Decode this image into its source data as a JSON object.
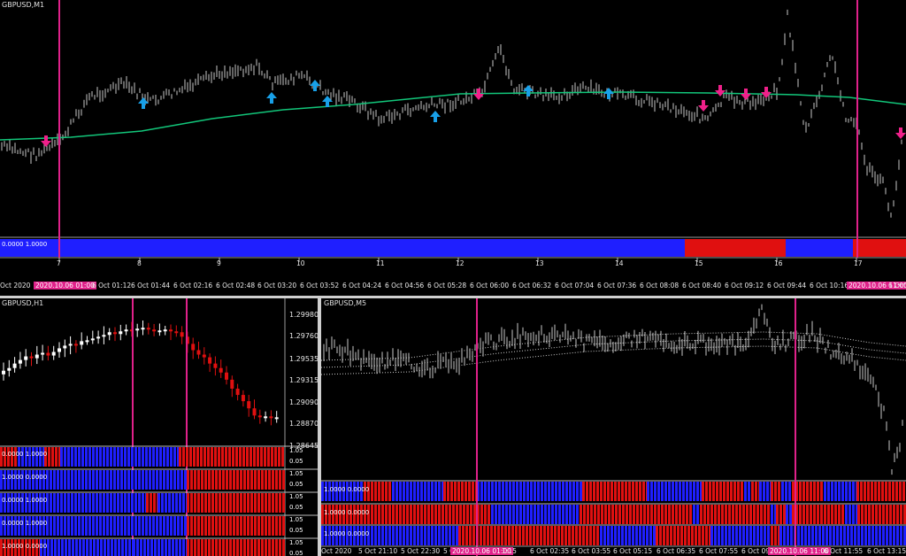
{
  "colors": {
    "bull": "#1f1fff",
    "bear": "#e01010",
    "accent": "#e0218a",
    "ma": "#12c67a",
    "candle": "#c8c8c8",
    "arrow_up": "#18a0e8",
    "arrow_down": "#f0208a"
  },
  "top": {
    "symbol": "GBPUSD,M1",
    "indicator_label": "0.0000 1.0000",
    "hour_ticks": [
      "7",
      "8",
      "9",
      "10",
      "11",
      "12",
      "13",
      "14",
      "15",
      "16",
      "17"
    ],
    "time_ticks": [
      "Oct 2020",
      "2020.10.06 01:00",
      "6 Oct 01:12",
      "6 Oct 01:44",
      "6 Oct 02:16",
      "6 Oct 02:48",
      "6 Oct 03:20",
      "6 Oct 03:52",
      "6 Oct 04:24",
      "6 Oct 04:56",
      "6 Oct 05:28",
      "6 Oct 06:00",
      "6 Oct 06:32",
      "6 Oct 07:04",
      "6 Oct 07:36",
      "6 Oct 08:08",
      "6 Oct 08:40",
      "6 Oct 09:12",
      "6 Oct 09:44",
      "6 Oct 10:16",
      "2020.10.06 11:00",
      "6 Oct 11"
    ]
  },
  "bottom_left": {
    "symbol": "GBPUSD,H1",
    "price_ticks": [
      "1.29980",
      "1.29760",
      "1.29535",
      "1.29315",
      "1.29090",
      "1.28870",
      "1.28645"
    ],
    "ind_labels": [
      "0.0000 1.0000",
      "1.0000 0.0000",
      "0.0000 1.0000",
      "0.0000 1.0000",
      "1.0000 0.0000"
    ],
    "ind_scale": [
      "1.05",
      "0.05",
      "1.05",
      "0.05",
      "1.05",
      "0.05",
      "1.05",
      "0.05",
      "1.05",
      "0.05"
    ]
  },
  "bottom_right": {
    "symbol": "GBPUSD,M5",
    "ind_labels": [
      "1.0000 0.0000",
      "1.0000 0.0000",
      "1.0000 0.0000"
    ],
    "time_ticks": [
      "Oct 2020",
      "5 Oct 21:10",
      "5 Oct 22:30",
      "5 Oct 23:50",
      "2020.10.06 01:00",
      "1:15",
      "6 Oct 02:35",
      "6 Oct 03:55",
      "6 Oct 05:15",
      "6 Oct 06:35",
      "6 Oct 07:55",
      "6 Oct 09:1",
      "2020.10.06 11:00",
      "6 Oct 11:55",
      "6 Oct 13:15"
    ]
  }
}
